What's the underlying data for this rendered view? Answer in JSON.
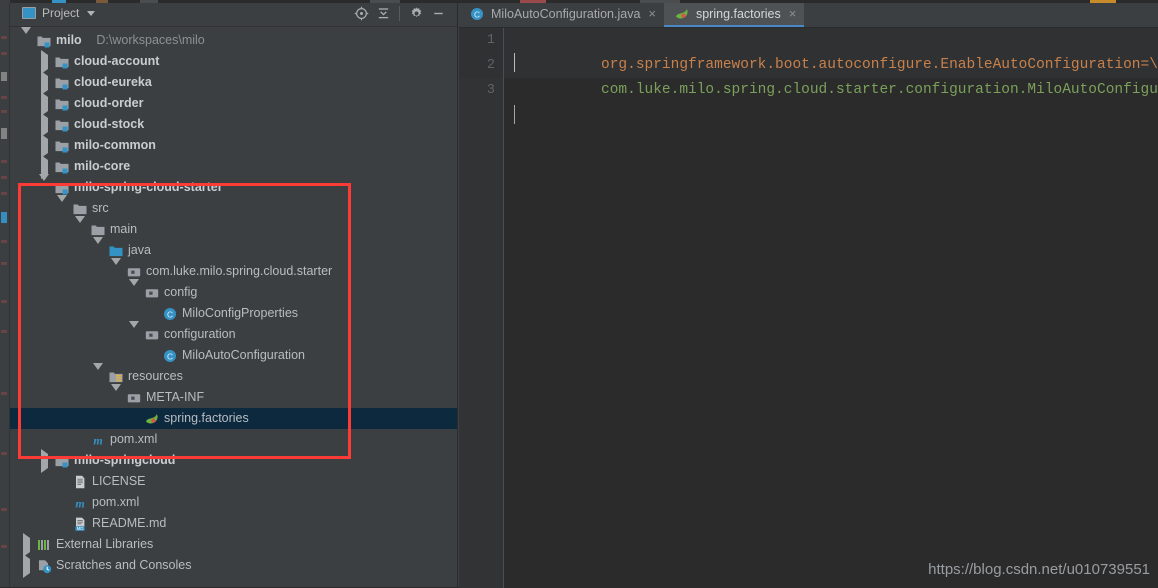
{
  "colors": {
    "panel_bg": "#3c3f41",
    "editor_bg": "#2b2b2b",
    "selection_bg": "#0d293e",
    "accent_blue": "#3592c4",
    "annotation_red": "#fc3a36",
    "code_key": "#c9814b",
    "code_value": "#7ba05b"
  },
  "panel": {
    "title": "Project",
    "dropdown_icon": "chevron-down-icon",
    "tools": [
      {
        "name": "locate-icon",
        "tooltip": "Select Opened File"
      },
      {
        "name": "collapse-all-icon",
        "tooltip": "Collapse All"
      },
      {
        "name": "settings-gear-icon",
        "tooltip": "Settings"
      },
      {
        "name": "hide-icon",
        "tooltip": "Hide"
      }
    ]
  },
  "tree": [
    {
      "label": "milo",
      "sublabel": "D:\\workspaces\\milo",
      "depth": 0,
      "twisty": "down",
      "icon": "module-icon",
      "bold": true,
      "selected": false
    },
    {
      "label": "cloud-account",
      "sublabel": "",
      "depth": 1,
      "twisty": "right",
      "icon": "module-icon",
      "bold": true,
      "selected": false
    },
    {
      "label": "cloud-eureka",
      "sublabel": "",
      "depth": 1,
      "twisty": "right",
      "icon": "module-icon",
      "bold": true,
      "selected": false
    },
    {
      "label": "cloud-order",
      "sublabel": "",
      "depth": 1,
      "twisty": "right",
      "icon": "module-icon",
      "bold": true,
      "selected": false
    },
    {
      "label": "cloud-stock",
      "sublabel": "",
      "depth": 1,
      "twisty": "right",
      "icon": "module-icon",
      "bold": true,
      "selected": false
    },
    {
      "label": "milo-common",
      "sublabel": "",
      "depth": 1,
      "twisty": "right",
      "icon": "module-icon",
      "bold": true,
      "selected": false
    },
    {
      "label": "milo-core",
      "sublabel": "",
      "depth": 1,
      "twisty": "right",
      "icon": "module-icon",
      "bold": true,
      "selected": false
    },
    {
      "label": "milo-spring-cloud-starter",
      "sublabel": "",
      "depth": 1,
      "twisty": "down",
      "icon": "module-icon",
      "bold": true,
      "selected": false
    },
    {
      "label": "src",
      "sublabel": "",
      "depth": 2,
      "twisty": "down",
      "icon": "folder-icon",
      "bold": false,
      "selected": false
    },
    {
      "label": "main",
      "sublabel": "",
      "depth": 3,
      "twisty": "down",
      "icon": "folder-icon",
      "bold": false,
      "selected": false
    },
    {
      "label": "java",
      "sublabel": "",
      "depth": 4,
      "twisty": "down",
      "icon": "source-root-icon",
      "bold": false,
      "selected": false
    },
    {
      "label": "com.luke.milo.spring.cloud.starter",
      "sublabel": "",
      "depth": 5,
      "twisty": "down",
      "icon": "package-icon",
      "bold": false,
      "selected": false
    },
    {
      "label": "config",
      "sublabel": "",
      "depth": 6,
      "twisty": "down",
      "icon": "package-icon",
      "bold": false,
      "selected": false
    },
    {
      "label": "MiloConfigProperties",
      "sublabel": "",
      "depth": 7,
      "twisty": "none",
      "icon": "java-class-icon",
      "bold": false,
      "selected": false
    },
    {
      "label": "configuration",
      "sublabel": "",
      "depth": 6,
      "twisty": "down",
      "icon": "package-icon",
      "bold": false,
      "selected": false
    },
    {
      "label": "MiloAutoConfiguration",
      "sublabel": "",
      "depth": 7,
      "twisty": "none",
      "icon": "java-class-icon",
      "bold": false,
      "selected": false
    },
    {
      "label": "resources",
      "sublabel": "",
      "depth": 4,
      "twisty": "down",
      "icon": "resource-root-icon",
      "bold": false,
      "selected": false
    },
    {
      "label": "META-INF",
      "sublabel": "",
      "depth": 5,
      "twisty": "down",
      "icon": "package-icon",
      "bold": false,
      "selected": false
    },
    {
      "label": "spring.factories",
      "sublabel": "",
      "depth": 6,
      "twisty": "none",
      "icon": "spring-leaf-icon",
      "bold": false,
      "selected": true
    },
    {
      "label": "pom.xml",
      "sublabel": "",
      "depth": 3,
      "twisty": "none",
      "icon": "maven-icon",
      "bold": false,
      "selected": false
    },
    {
      "label": "milo-springcloud",
      "sublabel": "",
      "depth": 1,
      "twisty": "right",
      "icon": "module-icon",
      "bold": true,
      "selected": false
    },
    {
      "label": "LICENSE",
      "sublabel": "",
      "depth": 2,
      "twisty": "none",
      "icon": "text-file-icon",
      "bold": false,
      "selected": false
    },
    {
      "label": "pom.xml",
      "sublabel": "",
      "depth": 2,
      "twisty": "none",
      "icon": "maven-icon",
      "bold": false,
      "selected": false
    },
    {
      "label": "README.md",
      "sublabel": "",
      "depth": 2,
      "twisty": "none",
      "icon": "markdown-file-icon",
      "bold": false,
      "selected": false
    },
    {
      "label": "External Libraries",
      "sublabel": "",
      "depth": 0,
      "twisty": "right",
      "icon": "libraries-icon",
      "bold": false,
      "selected": false
    },
    {
      "label": "Scratches and Consoles",
      "sublabel": "",
      "depth": 0,
      "twisty": "right",
      "icon": "scratches-icon",
      "bold": false,
      "selected": false
    }
  ],
  "editor": {
    "tabs": [
      {
        "label": "MiloAutoConfiguration.java",
        "icon": "java-class-icon",
        "active": false,
        "close": "×"
      },
      {
        "label": "spring.factories",
        "icon": "spring-leaf-icon",
        "active": true,
        "close": "×"
      }
    ],
    "line_numbers": [
      "1",
      "2",
      "3"
    ],
    "lines": [
      {
        "key": "org.springframework.boot.autoconfigure.EnableAutoConfiguration=\\",
        "value": ""
      },
      {
        "key": "",
        "value": "com.luke.milo.spring.cloud.starter.configuration.MiloAutoConfiguration"
      },
      {
        "key": "",
        "value": ""
      }
    ]
  },
  "watermark": {
    "text": "https://blog.csdn.net/u010739551"
  }
}
